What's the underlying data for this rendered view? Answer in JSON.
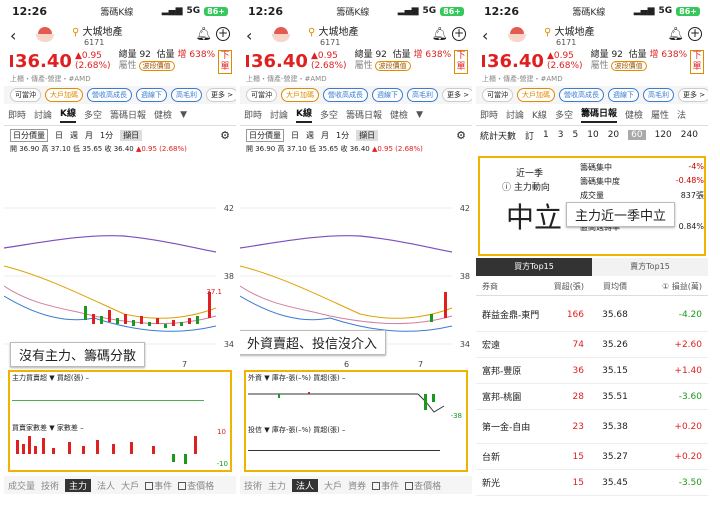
{
  "status": {
    "time": "12:26",
    "app": "籌碼K線",
    "network": "5G",
    "battery": "86+"
  },
  "stock": {
    "name": "大城地產",
    "code": "6171",
    "price": "36.40",
    "change": "▲0.95",
    "change_pct": "(2.68%)",
    "total_vol_label": "總量",
    "total_vol": "92",
    "est_label": "估量",
    "est_value": "增 638%",
    "attr_label": "屬性",
    "attr_tag": "波段價值",
    "order_label": "下單",
    "subline": "上櫃・傳產-營建・#AMD"
  },
  "chips": [
    "可當沖",
    "大戶加碼",
    "營收高成長",
    "週線下",
    "高毛利",
    "更多 >"
  ],
  "tabs_main": [
    "即時",
    "討論",
    "K線",
    "多空",
    "籌碼日報",
    "健檢",
    "屬性"
  ],
  "tabs_p3": [
    "即時",
    "討論",
    "K線",
    "多空",
    "籌碼日報",
    "健檢",
    "屬性",
    "法"
  ],
  "ctrl": {
    "freq": "日分價量",
    "periods": [
      "日",
      "週",
      "月",
      "1分"
    ],
    "range": "擷日"
  },
  "ohlc": {
    "text": "開 36.90 高 37.10 低 35.65 收 36.40",
    "chg": "▲0.95 (2.68%)"
  },
  "chart": {
    "y_labels": [
      "42",
      "38",
      "34"
    ],
    "x_labels": [
      "6",
      "7"
    ],
    "last_price_tag": "37.1"
  },
  "callout1": "沒有主力、籌碼分散",
  "callout2": "外資賣超、投信沒介入",
  "callout3": "主力近一季中立",
  "ind1": {
    "row1": "主力買賣超",
    "row1b": "買超(張)",
    "row2": "買賣家數差",
    "row2b": "家數差",
    "val_hi": "10",
    "val_lo": "-10",
    "dash": "–"
  },
  "ind2": {
    "row1": "外資",
    "row1a": "庫存-張(–%)",
    "row1b": "買超(張)",
    "row2": "投信",
    "row2a": "庫存-張(–%)",
    "row2b": "買超(張)",
    "val_neg": "-38",
    "dash": "–"
  },
  "bottom_tabs": [
    "成交量",
    "技術",
    "主力",
    "法人",
    "大戶"
  ],
  "bottom_tabs2": [
    "技術",
    "主力",
    "法人",
    "大戶",
    "資券"
  ],
  "checks": [
    "事件",
    "查價格"
  ],
  "p3": {
    "days_label": "統計天數",
    "days_sub": "訂",
    "days": [
      "1",
      "3",
      "5",
      "10",
      "20",
      "60",
      "120",
      "240"
    ],
    "days_sel": "60",
    "term": "近一季",
    "dir_label": "主力動向",
    "big": "中立",
    "stats": [
      [
        "籌碼集中",
        "-4%"
      ],
      [
        "籌碼集中度",
        "-0.48%"
      ],
      [
        "成交量",
        "837張"
      ],
      [
        "區間週轉率",
        "0.84%"
      ]
    ],
    "tabs": [
      "買方Top15",
      "賣方Top15"
    ],
    "head": [
      "券商",
      "買超(張)",
      "買均價",
      "① 損益(萬)"
    ],
    "rows": [
      [
        "群益金鼎-東門",
        "166",
        "35.68",
        "-4.20"
      ],
      [
        "宏遠",
        "74",
        "35.26",
        "+2.60"
      ],
      [
        "富邦-豐原",
        "36",
        "35.15",
        "+1.40"
      ],
      [
        "富邦-桃園",
        "28",
        "35.51",
        "-3.60"
      ],
      [
        "第一金-自由",
        "23",
        "35.38",
        "+0.20"
      ],
      [
        "台新",
        "15",
        "35.27",
        "+0.20"
      ],
      [
        "新光",
        "15",
        "35.45",
        "-3.50"
      ]
    ]
  },
  "colors": {
    "red": "#e02020",
    "green": "#1a9a1a",
    "highlight": "#f0b400"
  }
}
